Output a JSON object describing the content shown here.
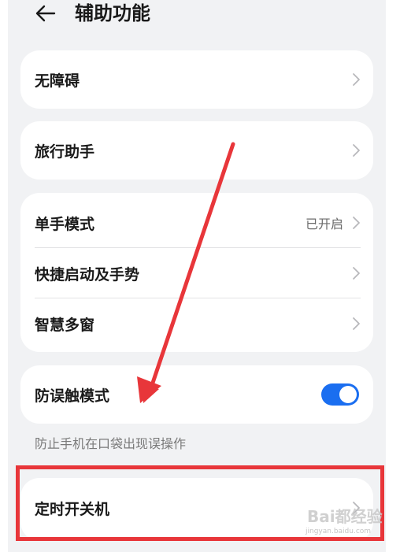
{
  "header": {
    "title": "辅助功能",
    "back_icon": "arrow-left-icon"
  },
  "cards": {
    "accessibility": {
      "label": "无障碍"
    },
    "travel_assistant": {
      "label": "旅行助手"
    },
    "one_hand_mode": {
      "label": "单手模式",
      "value": "已开启"
    },
    "shortcuts_gestures": {
      "label": "快捷启动及手势"
    },
    "smart_multiwindow": {
      "label": "智慧多窗"
    },
    "anti_mistouch": {
      "label": "防误触模式",
      "enabled": true
    },
    "scheduled_power": {
      "label": "定时开关机"
    }
  },
  "hint": {
    "text": "防止手机在口袋出现误操作"
  },
  "watermark": {
    "text": "Bai都经验",
    "url": "jingyan.baidu.com"
  },
  "colors": {
    "accent": "#1a6ef0",
    "annotation_red": "#e8363a",
    "background": "#f1f2f4",
    "card": "#ffffff"
  }
}
